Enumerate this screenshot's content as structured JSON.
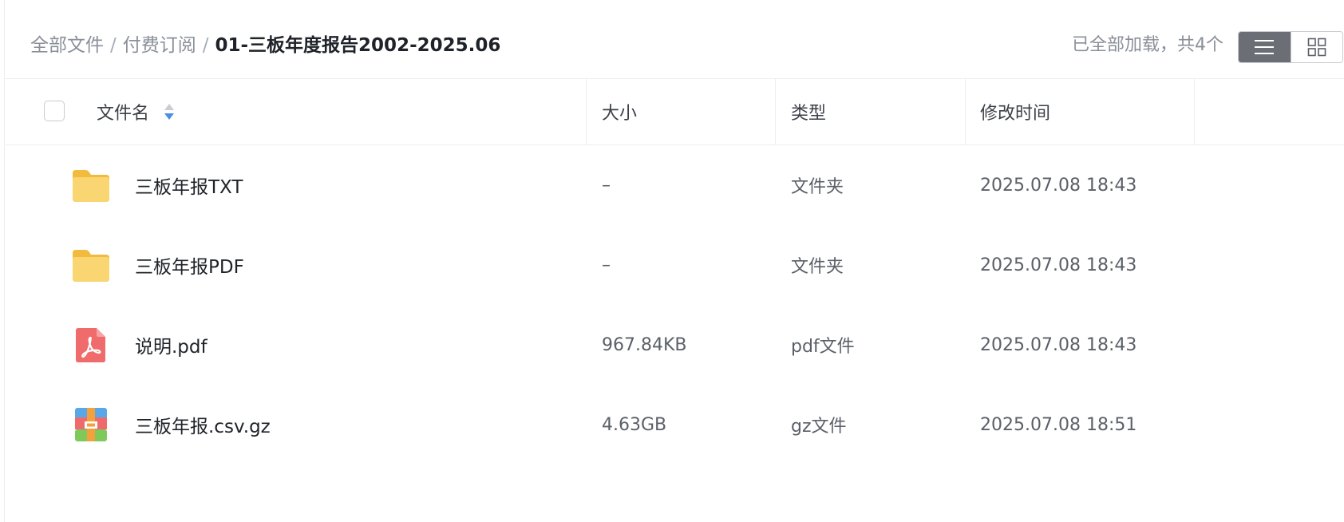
{
  "breadcrumb": {
    "items": [
      "全部文件",
      "付费订阅"
    ],
    "separator": "/",
    "current": "01-三板年度报告2002-2025.06"
  },
  "load_status": "已全部加载，共4个",
  "view_toggle": {
    "active": "list",
    "list_icon": "list-icon",
    "grid_icon": "grid-icon"
  },
  "table": {
    "headers": {
      "name": "文件名",
      "size": "大小",
      "type": "类型",
      "mtime": "修改时间"
    },
    "rows": [
      {
        "icon": "folder-icon",
        "name": "三板年报TXT",
        "size": "–",
        "type": "文件夹",
        "mtime": "2025.07.08 18:43"
      },
      {
        "icon": "folder-icon",
        "name": "三板年报PDF",
        "size": "–",
        "type": "文件夹",
        "mtime": "2025.07.08 18:43"
      },
      {
        "icon": "pdf-file-icon",
        "name": "说明.pdf",
        "size": "967.84KB",
        "type": "pdf文件",
        "mtime": "2025.07.08 18:43"
      },
      {
        "icon": "archive-file-icon",
        "name": "三板年报.csv.gz",
        "size": "4.63GB",
        "type": "gz文件",
        "mtime": "2025.07.08 18:51"
      }
    ]
  },
  "colors": {
    "folder": "#f7cf5b",
    "pdf": "#f06c6c",
    "sort_active": "#4a90e2",
    "toggle_active": "#6b6e74"
  }
}
